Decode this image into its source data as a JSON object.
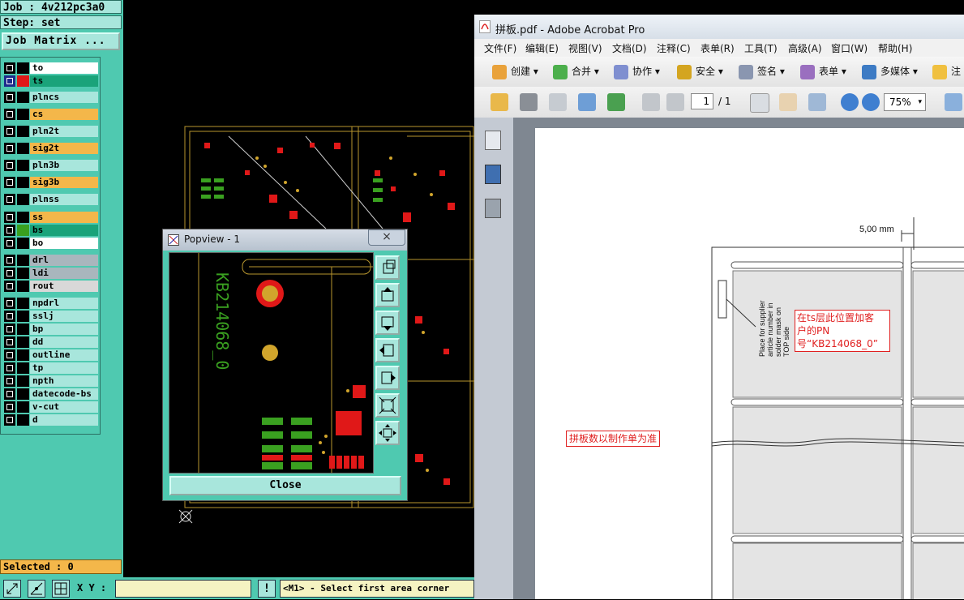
{
  "genesis": {
    "job_label": "Job : 4v212pc3a0",
    "step_label": "Step: set",
    "job_matrix_button": "Job Matrix ...",
    "layers": [
      {
        "name": "to",
        "color": "#ffffff",
        "swatch": "#000000"
      },
      {
        "name": "ts",
        "color": "#1aa37a",
        "swatch": "#e01818",
        "active": true
      },
      {
        "name": "plncs",
        "color": "#a8e6dc",
        "swatch": "#000000"
      },
      {
        "name": "cs",
        "color": "#f4b74a",
        "swatch": "#000000"
      },
      {
        "name": "pln2t",
        "color": "#a8e6dc",
        "swatch": "#000000"
      },
      {
        "name": "sig2t",
        "color": "#f4b74a",
        "swatch": "#000000"
      },
      {
        "name": "pln3b",
        "color": "#a8e6dc",
        "swatch": "#000000"
      },
      {
        "name": "sig3b",
        "color": "#f4b74a",
        "swatch": "#000000"
      },
      {
        "name": "plnss",
        "color": "#a8e6dc",
        "swatch": "#000000"
      },
      {
        "name": "ss",
        "color": "#f4b74a",
        "swatch": "#000000"
      },
      {
        "name": "bs",
        "color": "#1aa37a",
        "swatch": "#3aa020"
      },
      {
        "name": "bo",
        "color": "#ffffff",
        "swatch": "#000000"
      },
      {
        "name": "drl",
        "color": "#a9b6bd",
        "swatch": "#000000"
      },
      {
        "name": "ldi",
        "color": "#a9b6bd",
        "swatch": "#000000"
      },
      {
        "name": "rout",
        "color": "#d8d8d8",
        "swatch": "#000000"
      },
      {
        "name": "npdrl",
        "color": "#a8e6dc",
        "swatch": "#000000"
      },
      {
        "name": "sslj",
        "color": "#a8e6dc",
        "swatch": "#000000"
      },
      {
        "name": "bp",
        "color": "#a8e6dc",
        "swatch": "#000000"
      },
      {
        "name": "dd",
        "color": "#a8e6dc",
        "swatch": "#000000"
      },
      {
        "name": "outline",
        "color": "#a8e6dc",
        "swatch": "#000000"
      },
      {
        "name": "tp",
        "color": "#a8e6dc",
        "swatch": "#000000"
      },
      {
        "name": "npth",
        "color": "#a8e6dc",
        "swatch": "#000000"
      },
      {
        "name": "datecode-bs",
        "color": "#a8e6dc",
        "swatch": "#000000"
      },
      {
        "name": "v-cut",
        "color": "#a8e6dc",
        "swatch": "#000000"
      },
      {
        "name": "d",
        "color": "#a8e6dc",
        "swatch": "#000000"
      }
    ],
    "selected_label": "Selected : 0",
    "xy_label": "X Y :",
    "xy_value": "",
    "prompt": "<M1> - Select first area corner"
  },
  "popview": {
    "title": "Popview - 1",
    "close_x": "×",
    "close_button": "Close",
    "board_text": "KB214068_0"
  },
  "acrobat": {
    "title": "拼板.pdf - Adobe Acrobat Pro",
    "menu": [
      "文件(F)",
      "编辑(E)",
      "视图(V)",
      "文档(D)",
      "注释(C)",
      "表单(R)",
      "工具(T)",
      "高级(A)",
      "窗口(W)",
      "帮助(H)"
    ],
    "toolbar": [
      "创建",
      "合并",
      "协作",
      "安全",
      "签名",
      "表单",
      "多媒体",
      "注"
    ],
    "page_current": "1",
    "page_total": "/ 1",
    "zoom": "75%",
    "pdf": {
      "dimension": "5,00 mm",
      "supplier_note": [
        "Place for supplier",
        "article number in",
        "solder mask on",
        "TOP side"
      ],
      "red_note": [
        "在ts层此位置加客",
        "户的PN",
        "号“KB214068_0”"
      ],
      "panel_note": "拼板数以制作单为准"
    }
  }
}
